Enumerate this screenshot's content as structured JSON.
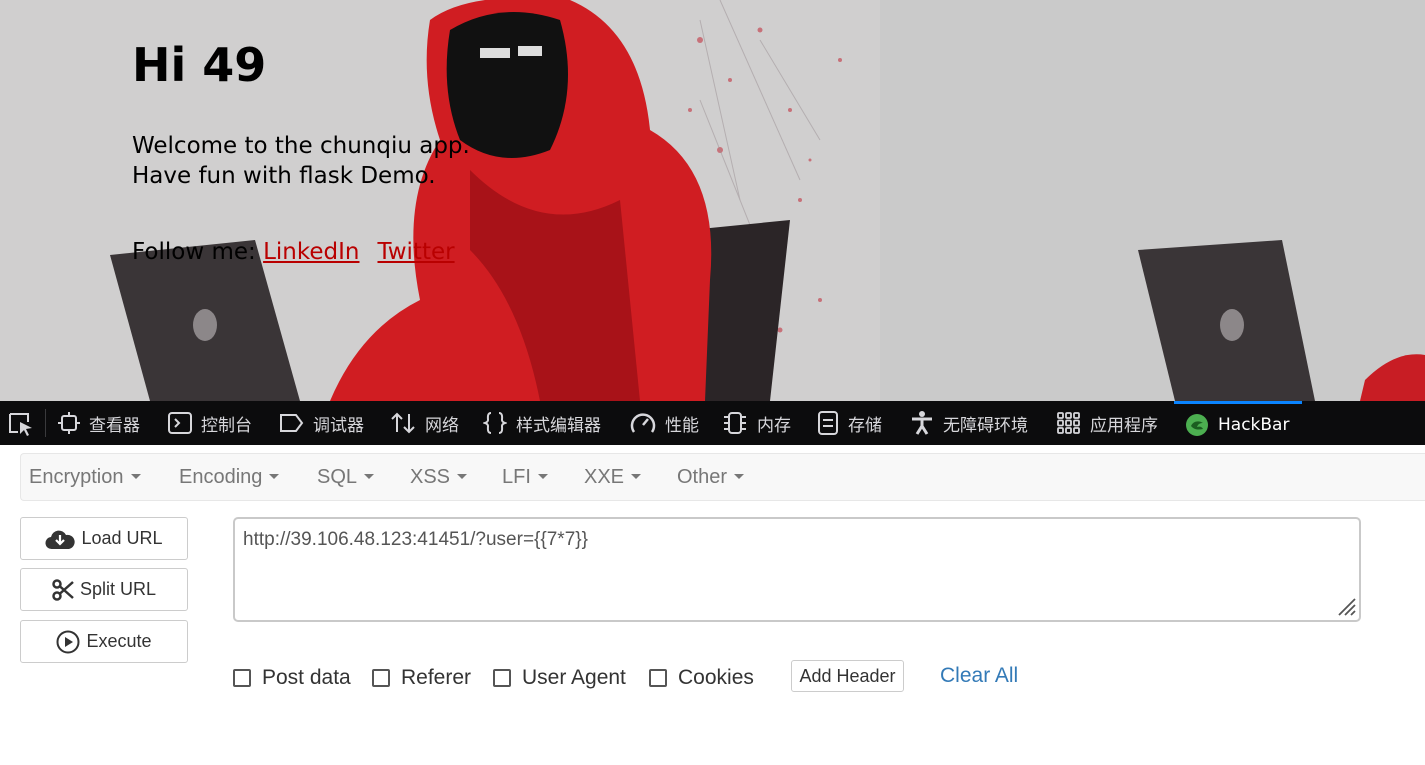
{
  "page": {
    "title": "Hi 49",
    "welcome_line1": "Welcome to the chunqiu app.",
    "welcome_line2": "Have fun with flask Demo.",
    "follow_label": "Follow me: ",
    "links": [
      "LinkedIn",
      "Twitter"
    ]
  },
  "devtools": {
    "tabs": [
      {
        "label": "查看器",
        "icon": "inspector-icon"
      },
      {
        "label": "控制台",
        "icon": "console-icon"
      },
      {
        "label": "调试器",
        "icon": "debugger-icon"
      },
      {
        "label": "网络",
        "icon": "network-icon"
      },
      {
        "label": "样式编辑器",
        "icon": "style-editor-icon"
      },
      {
        "label": "性能",
        "icon": "performance-icon"
      },
      {
        "label": "内存",
        "icon": "memory-icon"
      },
      {
        "label": "存储",
        "icon": "storage-icon"
      },
      {
        "label": "无障碍环境",
        "icon": "accessibility-icon"
      },
      {
        "label": "应用程序",
        "icon": "application-icon"
      },
      {
        "label": "HackBar",
        "icon": "hackbar-icon",
        "active": true
      }
    ],
    "active_tab_color": "#0a84ff"
  },
  "hackbar": {
    "menu": [
      "Encryption",
      "Encoding",
      "SQL",
      "XSS",
      "LFI",
      "XXE",
      "Other"
    ],
    "buttons": {
      "load_url": "Load URL",
      "split_url": "Split URL",
      "execute": "Execute"
    },
    "url_value": "http://39.106.48.123:41451/?user={{7*7}}",
    "options": {
      "post_data": "Post data",
      "referer": "Referer",
      "user_agent": "User Agent",
      "cookies": "Cookies"
    },
    "add_header": "Add Header",
    "clear_all": "Clear All"
  }
}
